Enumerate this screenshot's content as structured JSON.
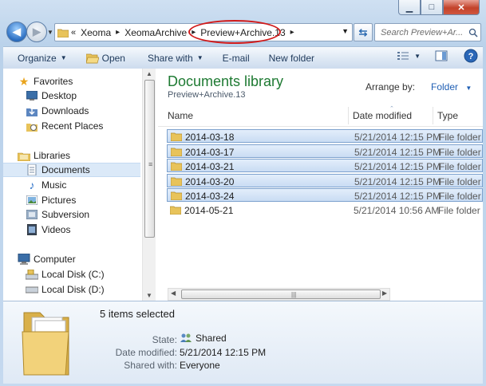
{
  "navigation": {
    "breadcrumbs": [
      "Xeoma",
      "XeomaArchive",
      "Preview+Archive.13"
    ],
    "search_placeholder": "Search Preview+Ar..."
  },
  "toolbar": {
    "organize": "Organize",
    "open": "Open",
    "share_with": "Share with",
    "email": "E-mail",
    "new_folder": "New folder"
  },
  "sidebar": {
    "groups": [
      {
        "label": "Favorites",
        "items": [
          "Desktop",
          "Downloads",
          "Recent Places"
        ]
      },
      {
        "label": "Libraries",
        "items": [
          "Documents",
          "Music",
          "Pictures",
          "Subversion",
          "Videos"
        ]
      },
      {
        "label": "Computer",
        "items": [
          "Local Disk (C:)",
          "Local Disk (D:)"
        ]
      }
    ],
    "selected": "Documents"
  },
  "library": {
    "title": "Documents library",
    "subtitle": "Preview+Archive.13",
    "arrange_label": "Arrange by:",
    "arrange_value": "Folder"
  },
  "columns": {
    "name": "Name",
    "date_modified": "Date modified",
    "type": "Type"
  },
  "files": [
    {
      "name": "2014-03-18",
      "date": "5/21/2014 12:15 PM",
      "type": "File folder",
      "selected": true
    },
    {
      "name": "2014-03-17",
      "date": "5/21/2014 12:15 PM",
      "type": "File folder",
      "selected": true
    },
    {
      "name": "2014-03-21",
      "date": "5/21/2014 12:15 PM",
      "type": "File folder",
      "selected": true
    },
    {
      "name": "2014-03-20",
      "date": "5/21/2014 12:15 PM",
      "type": "File folder",
      "selected": true
    },
    {
      "name": "2014-03-24",
      "date": "5/21/2014 12:15 PM",
      "type": "File folder",
      "selected": true
    },
    {
      "name": "2014-05-21",
      "date": "5/21/2014 10:56 AM",
      "type": "File folder",
      "selected": false
    }
  ],
  "details": {
    "selection_count": "5 items selected",
    "state_label": "State:",
    "state_value": "Shared",
    "date_label": "Date modified:",
    "date_value": "5/21/2014 12:15 PM",
    "shared_label": "Shared with:",
    "shared_value": "Everyone"
  },
  "colors": {
    "accent": "#1f5fb4",
    "library_title": "#1e7a32",
    "highlight_oval": "#d11a1a"
  }
}
